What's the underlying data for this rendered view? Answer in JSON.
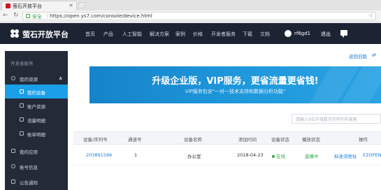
{
  "browser": {
    "tab_title": "萤石开放平台",
    "tab_close": "×",
    "secure_label": "安全",
    "url": "https://open.ys7.com/console/device.html"
  },
  "header": {
    "logo_text": "萤石开放平台",
    "nav": [
      "首页",
      "产品",
      "人工智能",
      "解决方案",
      "案例",
      "价格",
      "开发者服务",
      "下载",
      "文档"
    ],
    "user_name": "rf6gd1",
    "logout_label": "退出"
  },
  "sidebar": {
    "section_title": "开发者服务",
    "group_label": "我的资源",
    "group_chevron": "▲",
    "items": [
      {
        "label": "我的设备",
        "icon": "device-icon",
        "active": true
      },
      {
        "label": "账户资源",
        "icon": "chart-icon",
        "active": false
      },
      {
        "label": "流量明细",
        "icon": "traffic-icon",
        "active": false
      },
      {
        "label": "账单明细",
        "icon": "bill-icon",
        "active": false
      }
    ],
    "bottom_items": [
      {
        "label": "我的应用",
        "icon": "apps-icon"
      },
      {
        "label": "账号信息",
        "icon": "account-icon"
      },
      {
        "label": "公告通知",
        "icon": "notice-icon"
      }
    ]
  },
  "main": {
    "back_link": "返回旧版",
    "banner": {
      "title": "升级企业版，VIP服务，更省流量更省钱!",
      "subtitle": "VIP服务包含\"一对一技术支持和数据分析功能\""
    },
    "search_placeholder": "请输入9位字母数字的序列号搜索",
    "table": {
      "headers": [
        "设备/序列号",
        "通道号",
        "设备名称",
        "添加时间",
        "设备状态",
        "播放状态",
        "操作"
      ],
      "rows": [
        {
          "serial": "203891586",
          "channel": "1",
          "name": "办公室",
          "added": "2018-04-23",
          "status": "在线",
          "play": "直播中",
          "op_std": "标准流地址",
          "op_ezopen": "EZOPEN"
        }
      ]
    }
  },
  "colors": {
    "header_bg": "#1c2433",
    "sidebar_bg": "#232b38",
    "accent": "#1a9fe8",
    "online": "#2ea84a"
  }
}
